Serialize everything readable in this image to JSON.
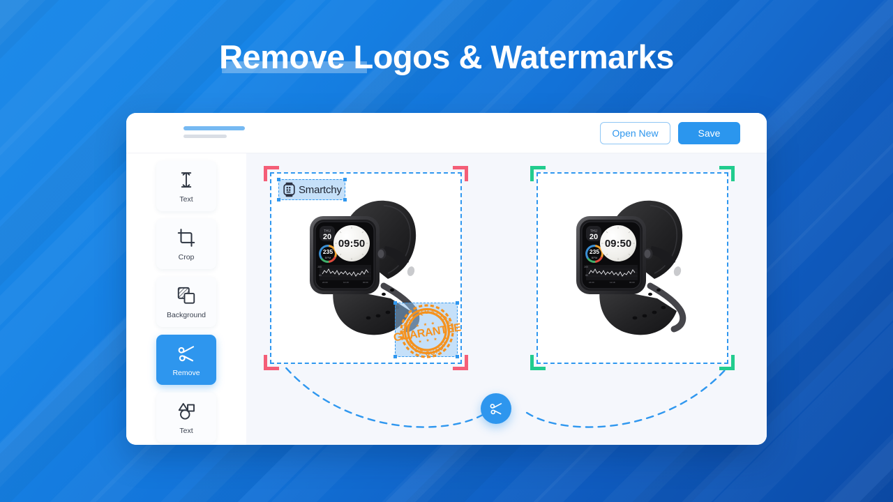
{
  "headline": {
    "text": "Remove Logos & Watermarks",
    "highlight_word": "Remove",
    "color": "#ffffff",
    "highlight_color": "rgba(255,255,255,0.30)"
  },
  "background": {
    "gradient_from": "#1e8ae8",
    "gradient_to": "#0b4ba8"
  },
  "app": {
    "topbar": {
      "title_placeholder_bar": "",
      "subtitle_placeholder_bar": "",
      "buttons": [
        {
          "label": "Open New",
          "style": "outline",
          "color": "#2e96ee"
        },
        {
          "label": "Save",
          "style": "primary",
          "color": "#2b96ee"
        }
      ]
    },
    "sidebar": {
      "items": [
        {
          "label": "Text",
          "icon": "text-cursor-icon",
          "active": false
        },
        {
          "label": "Crop",
          "icon": "crop-icon",
          "active": false
        },
        {
          "label": "Background",
          "icon": "layers-icon",
          "active": false
        },
        {
          "label": "Remove",
          "icon": "scissors-icon",
          "active": true
        },
        {
          "label": "Text",
          "icon": "shapes-icon",
          "active": false
        }
      ],
      "active_color": "#2e96ee"
    },
    "canvas": {
      "background_color": "#f5f7fc",
      "panels": [
        {
          "id": "before",
          "corner_color": "#f45e77",
          "dash_color": "#2f97ef",
          "watermarks": [
            {
              "type": "logo",
              "text": "Smartchy",
              "icon": "smartwatch-icon",
              "selected": true
            },
            {
              "type": "badge",
              "text_top": "BEST QUALITY",
              "text_main": "GUARANTEE",
              "text_bottom": "BEST QUALITY",
              "color": "#f5921e",
              "selected": true
            }
          ]
        },
        {
          "id": "after",
          "corner_color": "#22cc8e",
          "dash_color": "#2f97ef",
          "watermarks": []
        }
      ],
      "action_button": {
        "icon": "scissors-icon",
        "color": "#2e96ee"
      },
      "connector_color": "#2f97ef"
    },
    "product": {
      "name": "smartwatch",
      "watch_face": {
        "day": "THU",
        "date": "20",
        "time": "09:50",
        "heart_rate": "235",
        "heart_rate_unit": "BPM",
        "graph_max": "200",
        "graph_min": "80"
      }
    }
  }
}
